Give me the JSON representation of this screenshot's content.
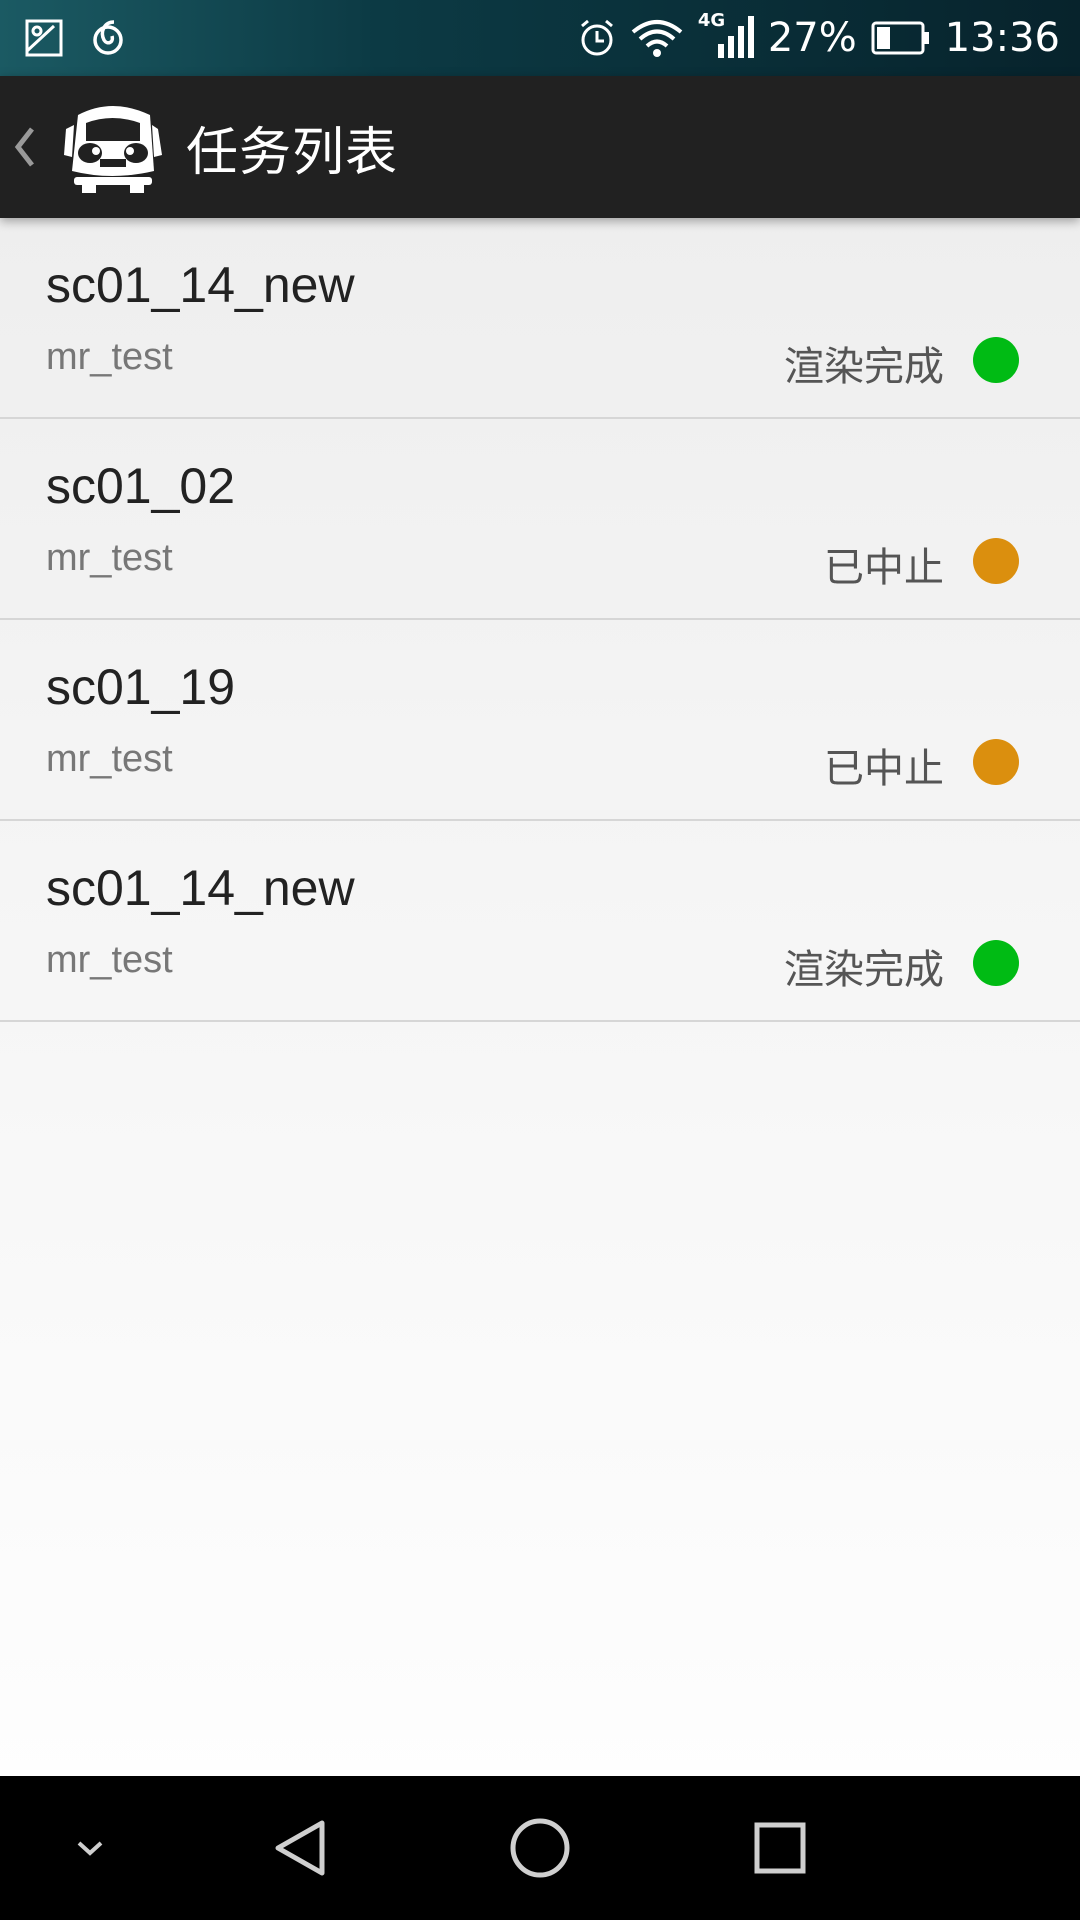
{
  "status_bar": {
    "battery_percent": "27%",
    "time": "13:36",
    "network_label": "4G",
    "icons": [
      "gallery-icon",
      "netease-music-icon",
      "alarm-icon",
      "wifi-icon",
      "signal-icon",
      "battery-icon"
    ]
  },
  "app_bar": {
    "title": "任务列表",
    "logo_icon": "bus-logo-icon",
    "back_icon": "chevron-left-icon"
  },
  "tasks": [
    {
      "name": "sc01_14_new",
      "user": "mr_test",
      "status": "渲染完成",
      "status_color": "#00bb14"
    },
    {
      "name": "sc01_02",
      "user": "mr_test",
      "status": "已中止",
      "status_color": "#db8f0e"
    },
    {
      "name": "sc01_19",
      "user": "mr_test",
      "status": "已中止",
      "status_color": "#db8f0e"
    },
    {
      "name": "sc01_14_new",
      "user": "mr_test",
      "status": "渲染完成",
      "status_color": "#00bb14"
    }
  ],
  "nav_bar": {
    "icons": [
      "chevron-down-icon",
      "back-triangle-icon",
      "home-circle-icon",
      "recents-square-icon"
    ]
  },
  "colors": {
    "app_bar_bg": "#212121",
    "status_complete": "#00bb14",
    "status_stopped": "#db8f0e"
  }
}
